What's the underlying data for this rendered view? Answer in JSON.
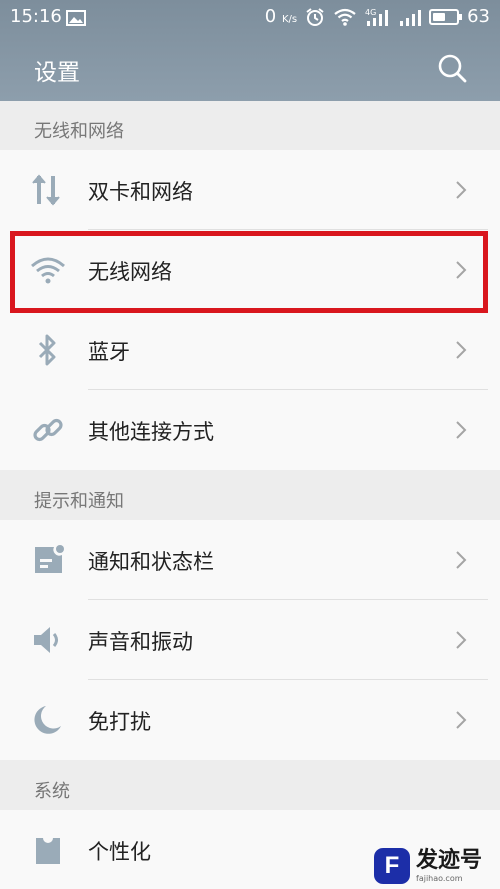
{
  "status_bar": {
    "time": "15:16",
    "net_speed": "0",
    "net_unit": "K/s",
    "signal_type": "4G",
    "battery": "63",
    "battery_level": 0.63
  },
  "header": {
    "title": "设置"
  },
  "sections": [
    {
      "title": "无线和网络",
      "items": [
        {
          "label": "双卡和网络",
          "icon": "dual-sim-icon"
        },
        {
          "label": "无线网络",
          "icon": "wifi-icon"
        },
        {
          "label": "蓝牙",
          "icon": "bluetooth-icon"
        },
        {
          "label": "其他连接方式",
          "icon": "link-icon"
        }
      ]
    },
    {
      "title": "提示和通知",
      "items": [
        {
          "label": "通知和状态栏",
          "icon": "notification-icon"
        },
        {
          "label": "声音和振动",
          "icon": "speaker-icon"
        },
        {
          "label": "免打扰",
          "icon": "moon-icon"
        }
      ]
    },
    {
      "title": "系统",
      "items": [
        {
          "label": "个性化",
          "icon": "personalize-icon"
        }
      ]
    }
  ],
  "watermark": {
    "name": "发迹号",
    "url": "fajihao.com",
    "color": "#1c2ea8"
  },
  "colors": {
    "header": "#8394a2",
    "icon": "#9aabb8",
    "highlight": "#d9171e"
  }
}
